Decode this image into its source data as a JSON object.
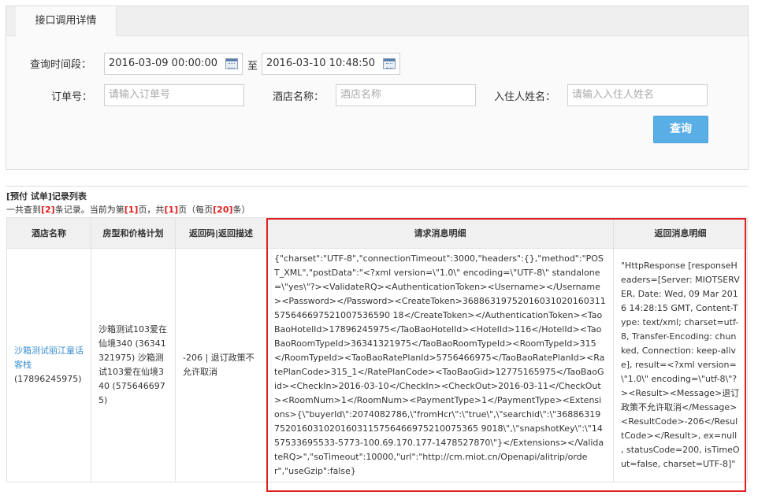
{
  "tab": {
    "label": "接口调用详情"
  },
  "search": {
    "time_label": "查询时间段：",
    "start_time": "2016-03-09 00:00:00",
    "to_label": "至",
    "end_time": "2016-03-10 10:48:50",
    "order_label": "订单号：",
    "order_placeholder": "请输入订单号",
    "hotel_label": "酒店名称：",
    "hotel_placeholder": "酒店名称",
    "guest_label": "入住人姓名：",
    "guest_placeholder": "请输入入住人姓名",
    "query_button": "查询"
  },
  "list": {
    "title": "[预付 试单]记录列表",
    "summary_pre": "一共查到",
    "total": "[2]",
    "summary_mid1": "条记录。当前为第",
    "current_page": "[1]",
    "summary_mid2": "页，共",
    "page_count": "[1]",
    "summary_mid3": "页（每页",
    "per_page": "[20]",
    "summary_end": "条）"
  },
  "table": {
    "headers": [
      "酒店名称",
      "房型和价格计划",
      "返回码|返回描述",
      "请求消息明细",
      "返回消息明细"
    ],
    "row": {
      "hotel_name": "沙箱测试丽江童话客栈",
      "hotel_id": "(17896245975)",
      "room_plan": "沙箱测试103爱在仙境340 (36341321975) 沙箱测试103爱在仙境340 (5756466975)",
      "return_code": "-206 | 退订政策不允许取消",
      "request": "{\"charset\":\"UTF-8\",\"connectionTimeout\":3000,\"headers\":{},\"method\":\"POST_XML\",\"postData\":\"<?xml version=\\\"1.0\\\" encoding=\\\"UTF-8\\\" standalone=\\\"yes\\\"?><ValidateRQ><AuthenticationToken><Username></Username><Password></Password><CreateToken>36886319752016031020160311575646697521007536590 18</CreateToken></AuthenticationToken><TaoBaoHotelId>17896245975</TaoBaoHotelId><HotelId>116</HotelId><TaoBaoRoomTypeId>36341321975</TaoBaoRoomTypeId><RoomTypeId>315</RoomTypeId><TaoBaoRatePlanId>5756466975</TaoBaoRatePlanId><RatePlanCode>315_1</RatePlanCode><TaoBaoGid>12775165975</TaoBaoGid><CheckIn>2016-03-10</CheckIn><CheckOut>2016-03-11</CheckOut><RoomNum>1</RoomNum><PaymentType>1</PaymentType><Extensions>{\\\"buyerId\\\":2074082786,\\\"fromHcr\\\":\\\"true\\\",\\\"searchid\\\":\\\"368863197520160310201603115756466975210075365 9018\\\",\\\"snapshotKey\\\":\\\"1457533695533-5773-100.69.170.177-1478527870\\\"}</Extensions></ValidateRQ>\",\"soTimeout\":10000,\"url\":\"http://cm.miot.cn/Openapi/alitrip/order\",\"useGzip\":false}",
      "response": "\"HttpResponse [responseHeaders=[Server: MIOTSERVER, Date: Wed, 09 Mar 2016 14:28:15 GMT, Content-Type: text/xml; charset=utf-8, Transfer-Encoding: chunked, Connection: keep-alive], result=<?xml version=\\\"1.0\\\" encoding=\\\"utf-8\\\"?><Result><Message>退订政策不允许取消</Message><ResultCode>-206</ResultCode></Result>, ex=null , statusCode=200, isTimeOut=false, charset=UTF-8]\""
    }
  }
}
